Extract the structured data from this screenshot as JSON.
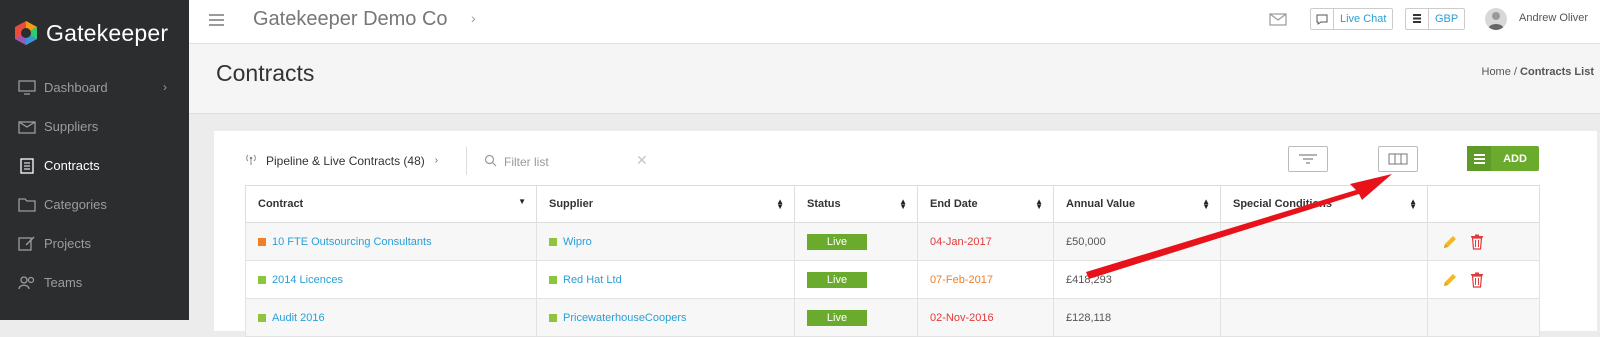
{
  "brand": {
    "name": "Gatekeeper"
  },
  "sidebar": {
    "items": [
      {
        "label": "Dashboard",
        "icon": "monitor-icon"
      },
      {
        "label": "Suppliers",
        "icon": "box-icon"
      },
      {
        "label": "Contracts",
        "icon": "document-icon",
        "active": true
      },
      {
        "label": "Categories",
        "icon": "folder-icon"
      },
      {
        "label": "Projects",
        "icon": "edit-icon"
      },
      {
        "label": "Teams",
        "icon": "users-icon"
      }
    ]
  },
  "topbar": {
    "org_title": "Gatekeeper Demo Co",
    "live_chat": "Live Chat",
    "currency": "GBP",
    "user_name": "Andrew Oliver"
  },
  "header": {
    "title": "Contracts",
    "breadcrumb": {
      "home": "Home",
      "separator": "/",
      "current": "Contracts List"
    }
  },
  "toolbar": {
    "pipeline_label": "Pipeline & Live Contracts (48)",
    "filter_placeholder": "Filter list",
    "add_label": "ADD"
  },
  "table": {
    "columns": [
      "Contract",
      "Supplier",
      "Status",
      "End Date",
      "Annual Value",
      "Special Conditions",
      ""
    ],
    "rows": [
      {
        "contract": "10 FTE Outsourcing Consultants",
        "contract_color": "#f07f2a",
        "supplier": "Wipro",
        "status": "Live",
        "end_date": "04-Jan-2017",
        "date_color": "red",
        "annual_value": "£50,000",
        "special_conditions": ""
      },
      {
        "contract": "2014 Licences",
        "contract_color": "#8cc63f",
        "supplier": "Red Hat Ltd",
        "status": "Live",
        "end_date": "07-Feb-2017",
        "date_color": "orange",
        "annual_value": "£418,293",
        "special_conditions": ""
      },
      {
        "contract": "Audit 2016",
        "contract_color": "#8cc63f",
        "supplier": "PricewaterhouseCoopers",
        "status": "Live",
        "end_date": "02-Nov-2016",
        "date_color": "red",
        "annual_value": "£128,118",
        "special_conditions": ""
      }
    ]
  },
  "colors": {
    "accent_green": "#6aab2e",
    "link_blue": "#2a9fd6",
    "annotation_red": "#e8121b",
    "sidebar_bg": "#2b2d2f"
  }
}
